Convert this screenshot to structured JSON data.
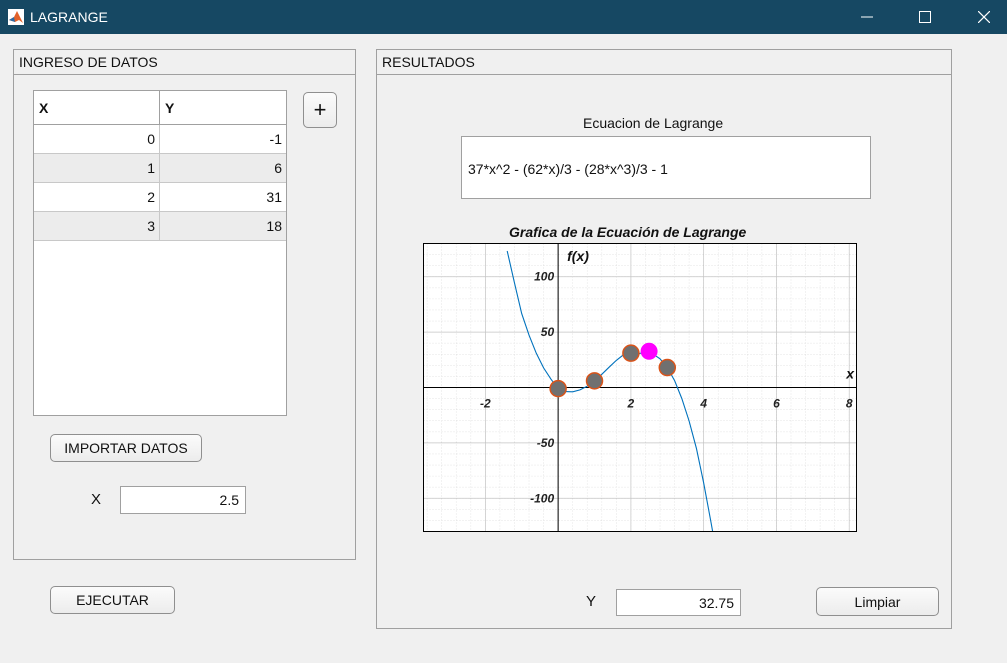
{
  "window": {
    "title": "LAGRANGE",
    "icon": "matlab-logo-icon",
    "controls": [
      "minimize-icon",
      "maximize-icon",
      "close-icon"
    ]
  },
  "input_panel": {
    "title": "INGRESO DE DATOS",
    "table": {
      "headers": [
        "X",
        "Y"
      ],
      "rows": [
        [
          "0",
          "-1"
        ],
        [
          "1",
          "6"
        ],
        [
          "2",
          "31"
        ],
        [
          "3",
          "18"
        ]
      ]
    },
    "add_row_label": "+",
    "import_label": "IMPORTAR DATOS",
    "x_label": "X",
    "x_value": "2.5"
  },
  "execute_label": "EJECUTAR",
  "results_panel": {
    "title": "RESULTADOS",
    "equation_label": "Ecuacion de Lagrange",
    "equation": "37*x^2 - (62*x)/3 - (28*x^3)/3 - 1",
    "y_label": "Y",
    "y_value": "32.75",
    "clear_label": "Limpiar"
  },
  "chart_data": {
    "type": "line",
    "title": "Grafica de la Ecuación de Lagrange",
    "xlabel": "x",
    "ylabel": "f(x)",
    "xlim": [
      -3.7,
      8.2
    ],
    "ylim": [
      -130,
      130
    ],
    "xticks": [
      -2,
      2,
      4,
      6,
      8
    ],
    "yticks": [
      -100,
      -50,
      50,
      100
    ],
    "grid": true,
    "minor_grid": true,
    "curve": {
      "expression": "37*x^2 - (62*x)/3 - (28*x^3)/3 - 1",
      "color": "#0072bd",
      "x": [
        -1.4,
        -1.2,
        -1.0,
        -0.8,
        -0.6,
        -0.4,
        -0.2,
        0.0,
        0.2,
        0.4,
        0.6,
        0.8,
        1.0,
        1.2,
        1.4,
        1.6,
        1.8,
        2.0,
        2.2,
        2.4,
        2.6,
        2.8,
        3.0,
        3.2,
        3.4,
        3.6,
        3.8,
        4.0,
        4.2,
        4.3
      ],
      "y": [
        123.2,
        94.3,
        66.7,
        47.3,
        30.9,
        17.7,
        7.6,
        -1.0,
        -3.7,
        -3.9,
        -2.2,
        1.2,
        6.0,
        11.9,
        18.3,
        24.5,
        29.6,
        31.0,
        30.5,
        31.8,
        30.4,
        25.9,
        18.0,
        6.2,
        -9.9,
        -30.2,
        -54.9,
        -86.3,
        -121.7,
        -139.9
      ]
    },
    "data_points": {
      "x": [
        0,
        1,
        2,
        3
      ],
      "y": [
        -1,
        6,
        31,
        18
      ],
      "fill": "#707070",
      "edge": "#d95319"
    },
    "query_point": {
      "x": 2.5,
      "y": 32.75,
      "color": "#ff00ff"
    }
  }
}
